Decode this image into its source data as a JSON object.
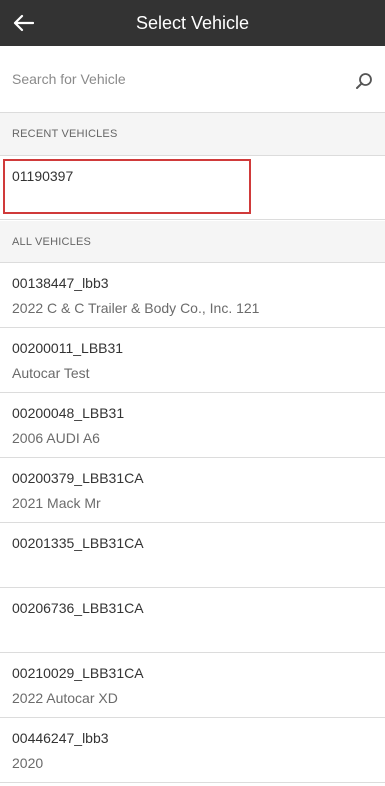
{
  "header": {
    "title": "Select Vehicle",
    "back_icon": "arrow-left-icon"
  },
  "search": {
    "placeholder": "Search for Vehicle",
    "value": "",
    "icon": "search-icon"
  },
  "recent": {
    "header": "RECENT VEHICLES",
    "items": [
      {
        "id": "01190397",
        "description": "",
        "highlighted": true
      }
    ]
  },
  "all": {
    "header": "ALL VEHICLES",
    "items": [
      {
        "id": "00138447_lbb3",
        "description": "2022 C & C Trailer & Body Co., Inc. 121"
      },
      {
        "id": "00200011_LBB31",
        "description": "Autocar Test"
      },
      {
        "id": "00200048_LBB31",
        "description": "2006 AUDI A6"
      },
      {
        "id": "00200379_LBB31CA",
        "description": "2021 Mack Mr"
      },
      {
        "id": "00201335_LBB31CA",
        "description": ""
      },
      {
        "id": "00206736_LBB31CA",
        "description": ""
      },
      {
        "id": "00210029_LBB31CA",
        "description": "2022 Autocar XD"
      },
      {
        "id": "00446247_lbb3",
        "description": "2020"
      }
    ]
  },
  "colors": {
    "app_bar": "#333333",
    "section_bg": "#f5f5f5",
    "highlight": "#d03a3a"
  }
}
